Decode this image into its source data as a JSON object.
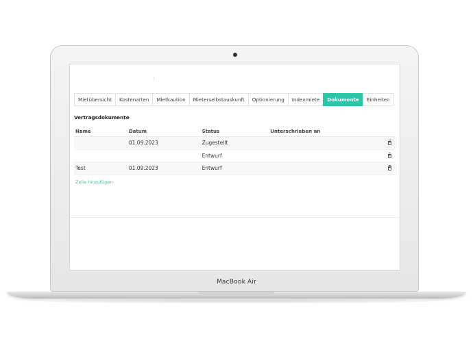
{
  "device": {
    "label": "MacBook Air"
  },
  "tabs": [
    {
      "label": "Mietübersicht",
      "active": false
    },
    {
      "label": "Kostenarten",
      "active": false
    },
    {
      "label": "Mietkaution",
      "active": false
    },
    {
      "label": "Mieterselbstauskunft",
      "active": false
    },
    {
      "label": "Optionierung",
      "active": false
    },
    {
      "label": "Indexmiete",
      "active": false
    },
    {
      "label": "Dokumente",
      "active": true
    },
    {
      "label": "Einheiten",
      "active": false
    }
  ],
  "section": {
    "title": "Vertragsdokumente"
  },
  "table": {
    "headers": {
      "name": "Name",
      "datum": "Datum",
      "status": "Status",
      "signed": "Unterschrieben an"
    },
    "rows": [
      {
        "name": "",
        "datum": "01.09.2023",
        "status": "Zugestellt",
        "signed": ""
      },
      {
        "name": "",
        "datum": "",
        "status": "Entwurf",
        "signed": ""
      },
      {
        "name": "Test",
        "datum": "01.09.2023",
        "status": "Entwurf",
        "signed": ""
      }
    ]
  },
  "actions": {
    "add_row_label": "Zeile hinzufügen"
  },
  "colors": {
    "accent": "#2ec4a8"
  },
  "icons": {
    "delete": "trash-icon"
  }
}
